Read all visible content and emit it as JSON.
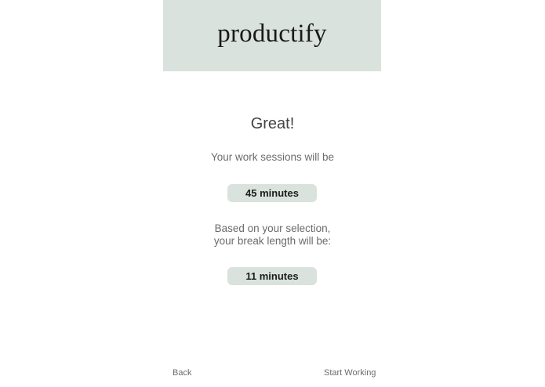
{
  "header": {
    "logo_text": "productify"
  },
  "main": {
    "title": "Great!",
    "work_intro": "Your work sessions will be",
    "work_value": "45 minutes",
    "break_intro_line1": "Based on your selection,",
    "break_intro_line2": "your break length will be:",
    "break_value": "11 minutes"
  },
  "footer": {
    "back_label": "Back",
    "start_label": "Start Working"
  },
  "colors": {
    "accent": "#d9e2dc",
    "text": "#555555"
  }
}
